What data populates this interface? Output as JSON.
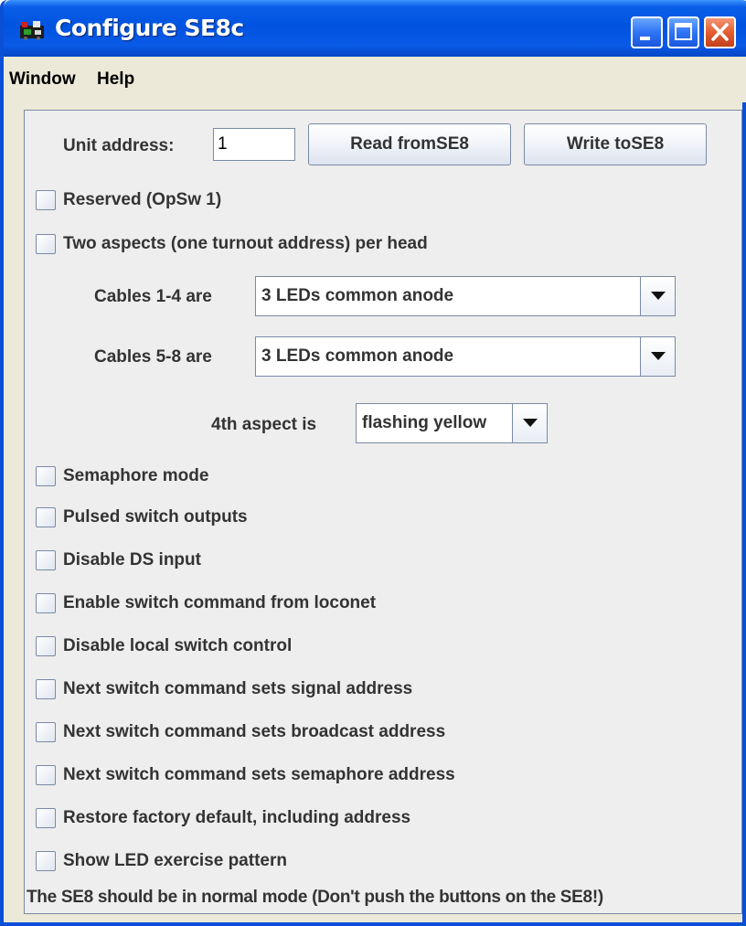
{
  "window": {
    "title": "Configure SE8c",
    "accent": "#0053e0"
  },
  "menubar": {
    "items": [
      {
        "label": "Window"
      },
      {
        "label": "Help"
      }
    ]
  },
  "unit": {
    "label": "Unit address:",
    "value": "1"
  },
  "buttons": {
    "read": "Read fromSE8",
    "write": "Write toSE8"
  },
  "checks": {
    "reserved": "Reserved (OpSw 1)",
    "two_aspects": "Two aspects (one turnout address) per head",
    "semaphore": "Semaphore mode",
    "pulsed": "Pulsed switch outputs",
    "disable_ds": "Disable DS input",
    "enable_loconet": "Enable switch command from loconet",
    "disable_local": "Disable local switch control",
    "signal_addr": "Next switch command sets signal address",
    "broadcast_addr": "Next switch command sets broadcast address",
    "semaphore_addr": "Next switch command sets semaphore address",
    "factory": "Restore factory default, including address",
    "led_pattern": "Show LED exercise pattern"
  },
  "cables_1_4": {
    "label": "Cables 1-4 are",
    "selected": "3 LEDs common anode"
  },
  "cables_5_8": {
    "label": "Cables 5-8 are",
    "selected": "3 LEDs common anode"
  },
  "fourth_aspect": {
    "label": "4th aspect is",
    "selected": "flashing yellow"
  },
  "note": "The SE8 should be in normal mode (Don't push the buttons on the SE8!)"
}
